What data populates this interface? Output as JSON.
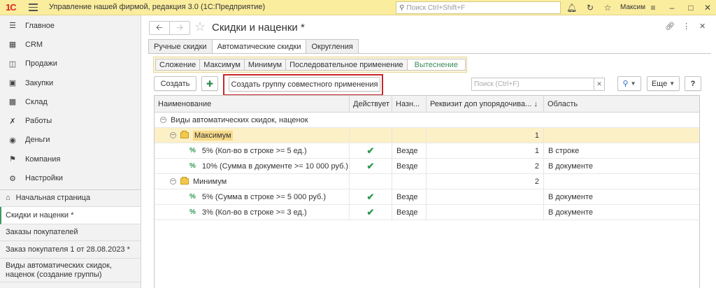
{
  "titlebar": {
    "logo": "1С",
    "title": "Управление нашей фирмой, редакция 3.0  (1С:Предприятие)",
    "search_placeholder": "Поиск Ctrl+Shift+F",
    "user": "Максим"
  },
  "sidebar": {
    "nav": [
      {
        "label": "Главное",
        "icon": "menu-lines-icon"
      },
      {
        "label": "CRM",
        "icon": "crm-icon"
      },
      {
        "label": "Продажи",
        "icon": "basket-icon"
      },
      {
        "label": "Закупки",
        "icon": "cart-icon"
      },
      {
        "label": "Склад",
        "icon": "warehouse-icon"
      },
      {
        "label": "Работы",
        "icon": "tools-icon"
      },
      {
        "label": "Деньги",
        "icon": "coin-icon"
      },
      {
        "label": "Компания",
        "icon": "flag-icon"
      },
      {
        "label": "Настройки",
        "icon": "gear-icon"
      }
    ],
    "history": [
      {
        "label": "Начальная страница"
      },
      {
        "label": "Скидки и наценки *"
      },
      {
        "label": "Заказы покупателей"
      },
      {
        "label": "Заказ покупателя 1 от 28.08.2023 *"
      },
      {
        "label_line1": "Виды автоматических скидок,",
        "label_line2": "наценок (создание группы)"
      }
    ]
  },
  "form": {
    "title": "Скидки и наценки *",
    "tabs": [
      "Ручные скидки",
      "Автоматические скидки",
      "Округления"
    ],
    "subtabs": [
      "Сложение",
      "Максимум",
      "Минимум",
      "Последовательное применение",
      "Вытеснение"
    ],
    "buttons": {
      "create": "Создать",
      "create_group": "Создать группу совместного применения",
      "more": "Еще"
    },
    "search_placeholder": "Поиск (Ctrl+F)",
    "table": {
      "columns": [
        "Наименование",
        "Действует",
        "Назн...",
        "Реквизит доп упорядочива...",
        "Область"
      ],
      "rows": [
        {
          "name": "Виды автоматических скидок, наценок",
          "active": "",
          "dest": "",
          "order": "",
          "area": ""
        },
        {
          "name": "Максимум",
          "active": "",
          "dest": "",
          "order": "1",
          "area": ""
        },
        {
          "name": "5% (Кол-во в строке >= 5 ед.)",
          "active": "✔",
          "dest": "Везде",
          "order": "1",
          "area": "В строке"
        },
        {
          "name": "10% (Сумма в документе >= 10 000 руб.)",
          "active": "✔",
          "dest": "Везде",
          "order": "2",
          "area": "В документе"
        },
        {
          "name": "Минимум",
          "active": "",
          "dest": "",
          "order": "2",
          "area": ""
        },
        {
          "name": "5% (Сумма в строке >= 5 000 руб.)",
          "active": "✔",
          "dest": "Везде",
          "order": "",
          "area": "В документе"
        },
        {
          "name": "3% (Кол-во в строке >= 3 ед.)",
          "active": "✔",
          "dest": "Везде",
          "order": "",
          "area": "В документе"
        }
      ]
    }
  }
}
